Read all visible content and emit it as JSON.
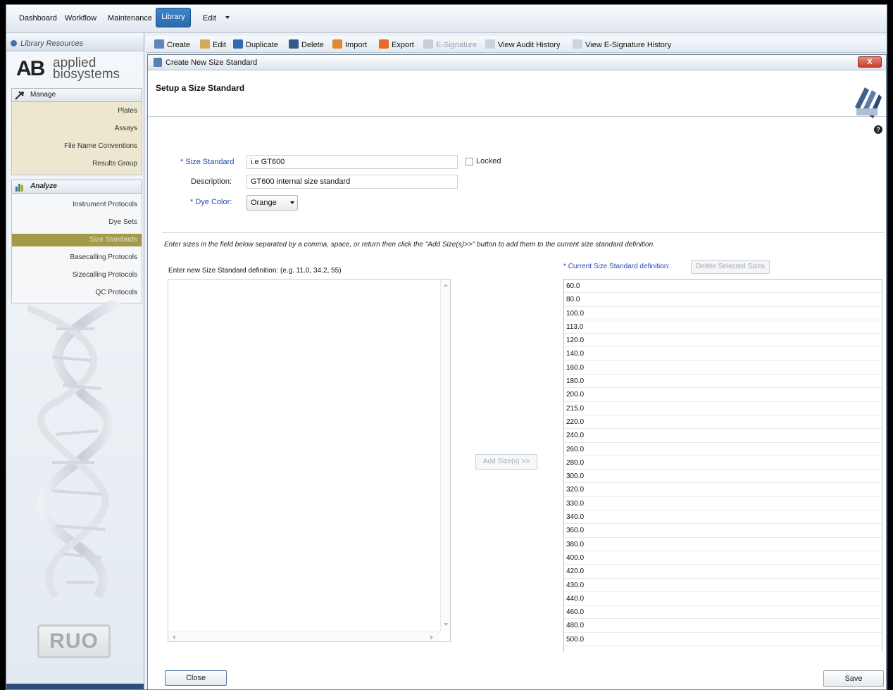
{
  "topnav": {
    "items": [
      "Dashboard",
      "Workflow",
      "Maintenance"
    ],
    "active": "Library",
    "edit": "Edit"
  },
  "sidebar": {
    "header": "Library Resources",
    "logo": {
      "ab": "AB",
      "line1": "applied",
      "line2": "biosystems"
    },
    "manage": {
      "title": "Manage",
      "items": [
        "Plates",
        "Assays",
        "File Name Conventions",
        "Results Group"
      ]
    },
    "analyze": {
      "title": "Analyze",
      "items": [
        "Instrument Protocols",
        "Dye Sets",
        "Size Standards",
        "Basecalling Protocols",
        "Sizecalling Protocols",
        "QC Protocols"
      ],
      "active_index": 2
    },
    "badge": "RUO"
  },
  "toolbar": {
    "create": "Create",
    "edit": "Edit",
    "duplicate": "Duplicate",
    "delete": "Delete",
    "import": "Import",
    "export": "Export",
    "esignature": "E-Signature",
    "audit": "View Audit History",
    "esig_history": "View E-Signature History"
  },
  "dialog": {
    "window_title": "Create New Size Standard",
    "close_x": "X",
    "title": "Setup a Size Standard",
    "help": "?",
    "form": {
      "size_standard_label": "Size Standard",
      "size_standard_value": "i.e GT600",
      "locked_label": "Locked",
      "description_label": "Description:",
      "description_value": "GT600 internal size standard",
      "dye_color_label": "Dye Color:",
      "dye_color_value": "Orange",
      "required_mark": "*"
    },
    "instructions": "Enter sizes in the field below separated by a comma, space, or return then click the \"Add Size(s)>>\" button to add them to the current size standard definition.",
    "new_def_label": "Enter new Size Standard definition: (e.g. 11.0, 34.2, 55)",
    "add_button": "Add Size(s) >>",
    "current_def_label": "Current Size Standard definition:",
    "delete_selected": "Delete Selected Sizes",
    "sizes": [
      "60.0",
      "80.0",
      "100.0",
      "113.0",
      "120.0",
      "140.0",
      "160.0",
      "180.0",
      "200.0",
      "215.0",
      "220.0",
      "240.0",
      "260.0",
      "280.0",
      "300.0",
      "320.0",
      "330.0",
      "340.0",
      "360.0",
      "380.0",
      "400.0",
      "420.0",
      "430.0",
      "440.0",
      "460.0",
      "480.0",
      "500.0"
    ],
    "close_button": "Close",
    "save_button": "Save"
  }
}
